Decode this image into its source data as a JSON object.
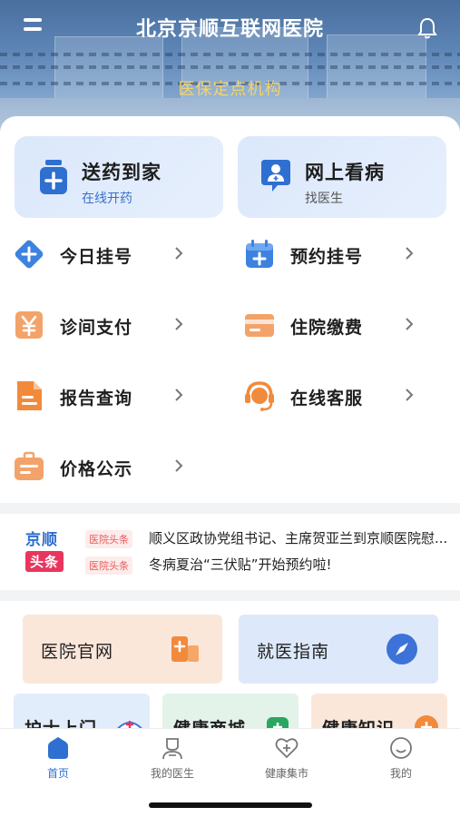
{
  "header": {
    "title": "北京京顺互联网医院",
    "subtitle": "医保定点机构",
    "menu_icon": "menu-icon",
    "bell_icon": "bell-icon"
  },
  "feature_tiles": [
    {
      "title": "送药到家",
      "sub": "在线开药",
      "icon": "medicine-bottle-icon"
    },
    {
      "title": "网上看病",
      "sub": "找医生",
      "icon": "doctor-icon"
    }
  ],
  "services": [
    {
      "label": "今日挂号",
      "icon": "plus-diamond-icon"
    },
    {
      "label": "预约挂号",
      "icon": "calendar-plus-icon"
    },
    {
      "label": "诊间支付",
      "icon": "yen-icon"
    },
    {
      "label": "住院缴费",
      "icon": "card-icon"
    },
    {
      "label": "报告查询",
      "icon": "document-icon"
    },
    {
      "label": "在线客服",
      "icon": "headset-icon"
    },
    {
      "label": "价格公示",
      "icon": "briefcase-icon"
    }
  ],
  "news": {
    "logo_top": "京顺",
    "logo_bottom": "头条",
    "items": [
      {
        "tag": "医院头条",
        "text": "顺义区政协党组书记、主席贺亚兰到京顺医院慰..."
      },
      {
        "tag": "医院头条",
        "text": "冬病夏治“三伏贴”开始预约啦!"
      }
    ]
  },
  "lower_tiles": {
    "wide": [
      {
        "label": "医院官网",
        "icon": "hospital-icon"
      },
      {
        "label": "就医指南",
        "icon": "compass-icon"
      }
    ],
    "small": [
      {
        "label": "护士上门",
        "icon": "nurse-icon"
      },
      {
        "label": "健康商城",
        "icon": "shop-icon"
      },
      {
        "label": "健康知识",
        "icon": "health-icon"
      }
    ]
  },
  "tabbar": [
    {
      "label": "首页",
      "icon": "home-icon",
      "active": true
    },
    {
      "label": "我的医生",
      "icon": "doctor-outline-icon",
      "active": false
    },
    {
      "label": "健康集市",
      "icon": "heart-plus-icon",
      "active": false
    },
    {
      "label": "我的",
      "icon": "smile-icon",
      "active": false
    }
  ],
  "colors": {
    "accent": "#2f6fd1",
    "orange": "#f28a3c",
    "subtitle_gold": "#f6d36b"
  }
}
